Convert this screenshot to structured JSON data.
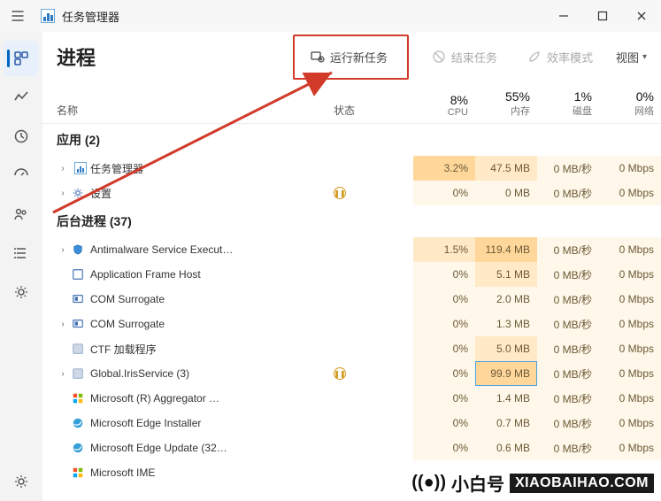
{
  "window": {
    "title": "任务管理器"
  },
  "toolbar": {
    "page_title": "进程",
    "run_new_task": "运行新任务",
    "end_task": "结束任务",
    "efficiency_mode": "效率模式",
    "view": "视图"
  },
  "columns": {
    "name": "名称",
    "status": "状态",
    "cpu": {
      "pct": "8%",
      "label": "CPU"
    },
    "mem": {
      "pct": "55%",
      "label": "内存"
    },
    "disk": {
      "pct": "1%",
      "label": "磁盘"
    },
    "net": {
      "pct": "0%",
      "label": "网络"
    }
  },
  "groups": {
    "apps": {
      "label": "应用 (2)"
    },
    "bg": {
      "label": "后台进程 (37)"
    }
  },
  "rows": [
    {
      "group": "apps",
      "caret": true,
      "icon": "taskmgr",
      "name": "任务管理器",
      "status": "",
      "cpu": "3.2%",
      "mem": "47.5 MB",
      "disk": "0 MB/秒",
      "net": "0 Mbps",
      "cpu_heat": 2,
      "mem_heat": 1,
      "disk_heat": 0,
      "net_heat": 0,
      "highlight_mem": false
    },
    {
      "group": "apps",
      "caret": true,
      "icon": "gear",
      "name": "设置",
      "status": "pause",
      "cpu": "0%",
      "mem": "0 MB",
      "disk": "0 MB/秒",
      "net": "0 Mbps",
      "cpu_heat": 0,
      "mem_heat": 0,
      "disk_heat": 0,
      "net_heat": 0
    },
    {
      "group": "bg",
      "caret": true,
      "icon": "shield",
      "name": "Antimalware Service Execut…",
      "status": "",
      "cpu": "1.5%",
      "mem": "119.4 MB",
      "disk": "0 MB/秒",
      "net": "0 Mbps",
      "cpu_heat": 1,
      "mem_heat": 2,
      "disk_heat": 0,
      "net_heat": 0,
      "selected": true
    },
    {
      "group": "bg",
      "caret": false,
      "icon": "frame",
      "name": "Application Frame Host",
      "status": "",
      "cpu": "0%",
      "mem": "5.1 MB",
      "disk": "0 MB/秒",
      "net": "0 Mbps",
      "cpu_heat": 0,
      "mem_heat": 1,
      "disk_heat": 0,
      "net_heat": 0
    },
    {
      "group": "bg",
      "caret": false,
      "icon": "com",
      "name": "COM Surrogate",
      "status": "",
      "cpu": "0%",
      "mem": "2.0 MB",
      "disk": "0 MB/秒",
      "net": "0 Mbps",
      "cpu_heat": 0,
      "mem_heat": 0,
      "disk_heat": 0,
      "net_heat": 0
    },
    {
      "group": "bg",
      "caret": true,
      "icon": "com",
      "name": "COM Surrogate",
      "status": "",
      "cpu": "0%",
      "mem": "1.3 MB",
      "disk": "0 MB/秒",
      "net": "0 Mbps",
      "cpu_heat": 0,
      "mem_heat": 0,
      "disk_heat": 0,
      "net_heat": 0
    },
    {
      "group": "bg",
      "caret": false,
      "icon": "generic",
      "name": "CTF 加载程序",
      "status": "",
      "cpu": "0%",
      "mem": "5.0 MB",
      "disk": "0 MB/秒",
      "net": "0 Mbps",
      "cpu_heat": 0,
      "mem_heat": 1,
      "disk_heat": 0,
      "net_heat": 0
    },
    {
      "group": "bg",
      "caret": true,
      "icon": "generic",
      "name": "Global.IrisService (3)",
      "status": "pause",
      "cpu": "0%",
      "mem": "99.9 MB",
      "disk": "0 MB/秒",
      "net": "0 Mbps",
      "cpu_heat": 0,
      "mem_heat": 2,
      "disk_heat": 0,
      "net_heat": 0,
      "highlight_mem": true
    },
    {
      "group": "bg",
      "caret": false,
      "icon": "ms",
      "name": "Microsoft (R) Aggregator …",
      "status": "",
      "cpu": "0%",
      "mem": "1.4 MB",
      "disk": "0 MB/秒",
      "net": "0 Mbps",
      "cpu_heat": 0,
      "mem_heat": 0,
      "disk_heat": 0,
      "net_heat": 0
    },
    {
      "group": "bg",
      "caret": false,
      "icon": "edge",
      "name": "Microsoft Edge Installer",
      "status": "",
      "cpu": "0%",
      "mem": "0.7 MB",
      "disk": "0 MB/秒",
      "net": "0 Mbps",
      "cpu_heat": 0,
      "mem_heat": 0,
      "disk_heat": 0,
      "net_heat": 0
    },
    {
      "group": "bg",
      "caret": false,
      "icon": "edge",
      "name": "Microsoft Edge Update (32…",
      "status": "",
      "cpu": "0%",
      "mem": "0.6 MB",
      "disk": "0 MB/秒",
      "net": "0 Mbps",
      "cpu_heat": 0,
      "mem_heat": 0,
      "disk_heat": 0,
      "net_heat": 0
    },
    {
      "group": "bg",
      "caret": false,
      "icon": "ms",
      "name": "Microsoft IME",
      "status": "",
      "cpu": "",
      "mem": "",
      "disk": "",
      "net": "",
      "cpu_heat": -1,
      "mem_heat": -1,
      "disk_heat": -1,
      "net_heat": -1
    }
  ],
  "watermark": {
    "cn": "小白号",
    "en": "XIAOBAIHAO.COM"
  }
}
